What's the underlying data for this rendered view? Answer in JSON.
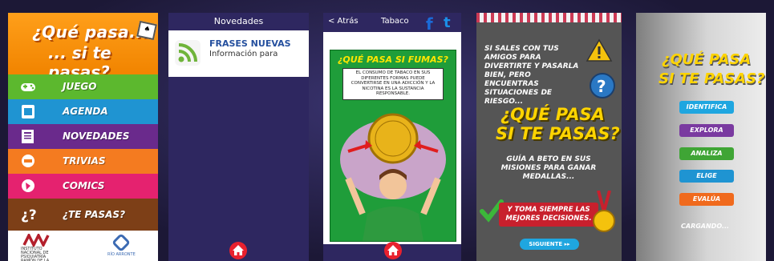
{
  "screen1": {
    "title_line1": "¿Qué pasa...",
    "title_line2": "... si te pasas?",
    "menu": [
      {
        "label": "JUEGO",
        "color": "#5cb82e",
        "icon": "gamepad-icon"
      },
      {
        "label": "AGENDA",
        "color": "#1f94d2",
        "icon": "agenda-icon"
      },
      {
        "label": "NOVEDADES",
        "color": "#6a2a8c",
        "icon": "news-icon"
      },
      {
        "label": "TRIVIAS",
        "color": "#f47b20",
        "icon": "trivia-icon"
      },
      {
        "label": "COMICS",
        "color": "#e5226f",
        "icon": "comic-icon"
      },
      {
        "label": "¿TE PASAS?",
        "color": "#7d3f17",
        "icon": "question-icon"
      }
    ],
    "institution": "INSTITUTO NACIONAL DE PSIQUIATRÍA RAMÓN DE LA FUENTE",
    "partner": "RÍO ARRONTE"
  },
  "screen2": {
    "header": "Novedades",
    "item_title": "FRASES NUEVAS",
    "item_subtitle": "Información para"
  },
  "screen3": {
    "back": "< Atrás",
    "category": "Tabaco",
    "facebook": "f",
    "twitter": "t",
    "comic_title": "¿QUÉ PASA SI FUMAS?",
    "comic_text": "EL CONSUMO DE TABACO EN SUS DIFERENTES FORMAS PUEDE CONVERTIRSE EN UNA ADICCIÓN Y LA NICOTINA ES LA SUSTANCIA RESPONSABLE."
  },
  "screen4": {
    "intro": "SI SALES CON TUS AMIGOS PARA DIVERTIRTE Y PASARLA BIEN, PERO ENCUENTRAS SITUACIONES DE RIESGO...",
    "title_line1": "¿QUÉ PASA",
    "title_line2": "SI TE PASAS?",
    "mission": "GUÍA A BETO EN SUS MISIONES PARA GANAR MEDALLAS...",
    "ribbon": "Y TOMA SIEMPRE LAS MEJORES DECISIONES.",
    "next": "SIGUIENTE ▸▸"
  },
  "screen5": {
    "title_line1": "¿QUÉ PASA",
    "title_line2": "SI TE PASAS?",
    "steps": [
      {
        "label": "IDENTIFICA",
        "color": "#1fa6e0"
      },
      {
        "label": "EXPLORA",
        "color": "#7a3aa0"
      },
      {
        "label": "ANALIZA",
        "color": "#3fa535"
      },
      {
        "label": "ELIGE",
        "color": "#1f94d2"
      },
      {
        "label": "EVALÚA",
        "color": "#f06a1d"
      }
    ],
    "loading": "CARGANDO..."
  }
}
